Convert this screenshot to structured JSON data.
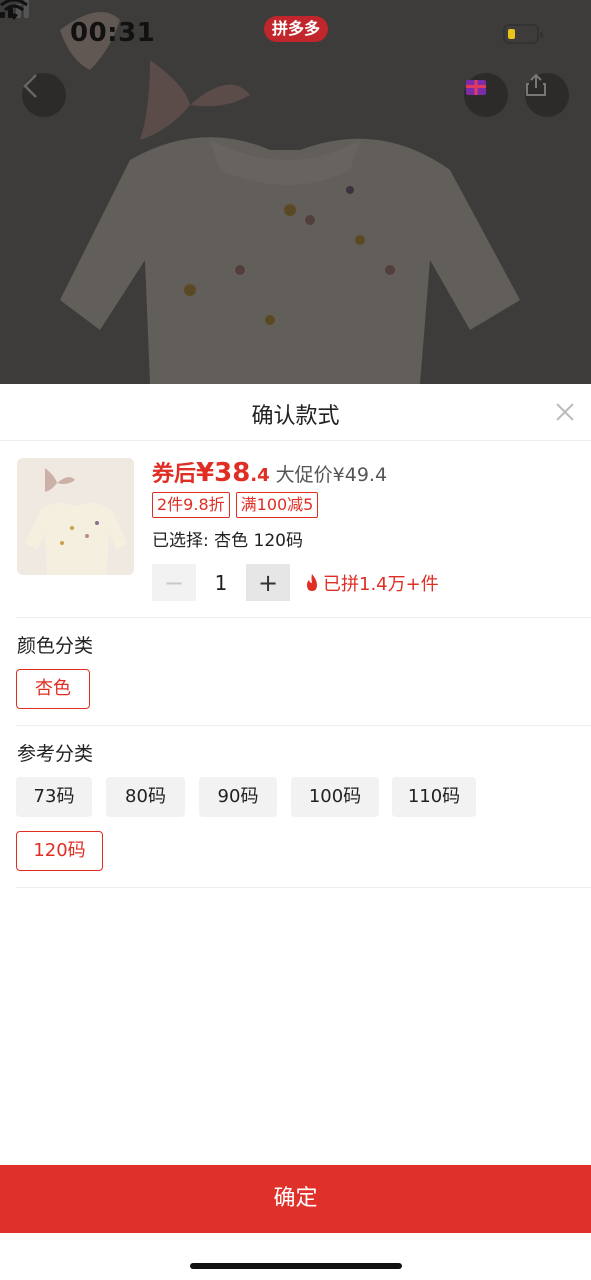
{
  "status_bar": {
    "time": "00:31",
    "app_badge": "拼多多"
  },
  "colors": {
    "accent": "#e02e24",
    "confirm": "#e0302a"
  },
  "icons": {
    "back": "chevron-left-icon",
    "gift": "gift-icon",
    "share": "share-icon",
    "close": "close-icon",
    "fire": "fire-icon"
  },
  "sheet": {
    "title": "确认款式",
    "price_prefix": "券后",
    "price_main": "¥38",
    "price_decimal": ".4",
    "original_price": "大促价¥49.4",
    "tags": [
      "2件9.8折",
      "满100减5"
    ],
    "selected": "已选择: 杏色 120码",
    "quantity": "1",
    "minus_label": "−",
    "plus_label": "+",
    "sold": "已拼1.4万+件"
  },
  "color_section": {
    "label": "颜色分类",
    "options": [
      "杏色"
    ],
    "selected": "杏色"
  },
  "size_section": {
    "label": "参考分类",
    "options": [
      "73码",
      "80码",
      "90码",
      "100码",
      "110码",
      "120码"
    ],
    "selected": "120码"
  },
  "confirm_label": "确定"
}
